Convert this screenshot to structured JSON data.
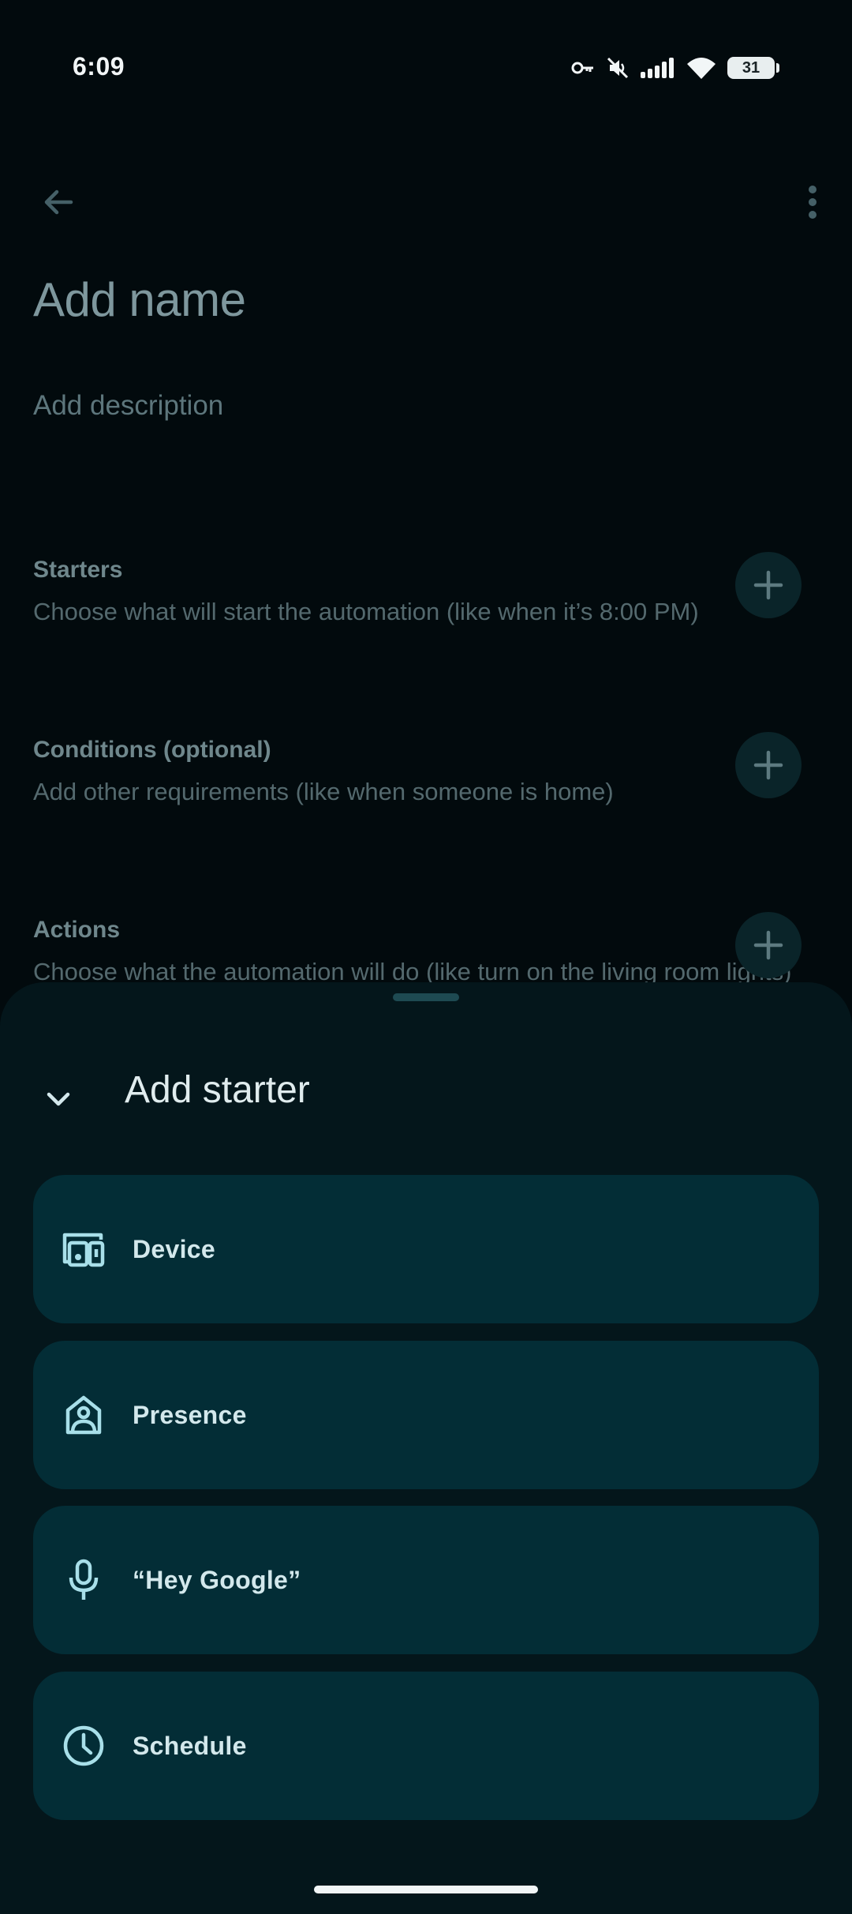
{
  "status_bar": {
    "time": "6:09",
    "battery": "31",
    "icons": [
      "vpn-key-icon",
      "mute-icon",
      "signal-icon",
      "wifi-icon",
      "battery-icon"
    ]
  },
  "top_bar": {
    "back_icon": "arrow-back-icon",
    "more_icon": "more-vert-icon"
  },
  "header": {
    "name_placeholder": "Add name",
    "description_placeholder": "Add description"
  },
  "sections": {
    "starters": {
      "title": "Starters",
      "description": "Choose what will start the automation (like when it’s 8:00 PM)"
    },
    "conditions": {
      "title": "Conditions (optional)",
      "description": "Add other requirements (like when someone is home)"
    },
    "actions": {
      "title": "Actions",
      "description": "Choose what the automation will do (like turn on the living room lights)"
    }
  },
  "sheet": {
    "title": "Add starter",
    "options": [
      {
        "label": "Device",
        "icon": "devices-icon"
      },
      {
        "label": "Presence",
        "icon": "home-person-icon"
      },
      {
        "label": "“Hey Google”",
        "icon": "mic-icon"
      },
      {
        "label": "Schedule",
        "icon": "clock-icon"
      }
    ]
  },
  "colors": {
    "background": "#020a0d",
    "sheet": "#04161b",
    "card": "#032d36",
    "accent_icon": "#a8dfe9"
  }
}
